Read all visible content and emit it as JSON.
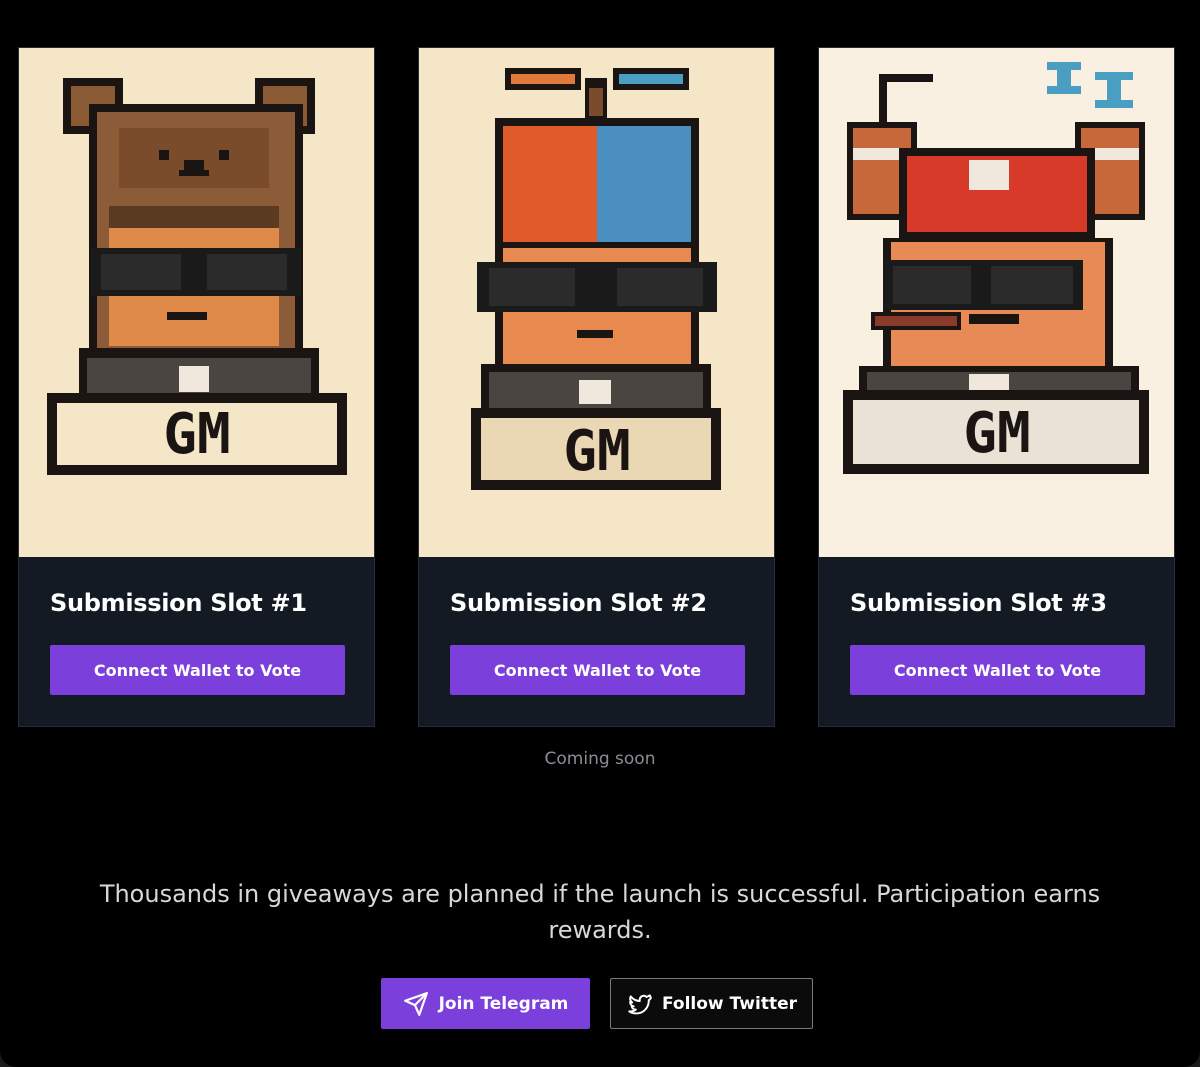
{
  "cards": [
    {
      "title": "Submission Slot #1",
      "button": "Connect Wallet to Vote",
      "art_badge": "GM",
      "art_icon": "bear-hat-pixel-avatar"
    },
    {
      "title": "Submission Slot #2",
      "button": "Connect Wallet to Vote",
      "art_badge": "GM",
      "art_icon": "propeller-cap-pixel-avatar"
    },
    {
      "title": "Submission Slot #3",
      "button": "Connect Wallet to Vote",
      "art_badge": "GM",
      "art_icon": "red-cap-cigar-pixel-avatar"
    }
  ],
  "status_text": "Coming soon",
  "promo_text": "Thousands in giveaways are planned if the launch is successful. Participation earns rewards.",
  "actions": {
    "telegram": {
      "label": "Join Telegram",
      "icon": "paper-plane-icon"
    },
    "twitter": {
      "label": "Follow Twitter",
      "icon": "twitter-bird-icon"
    }
  },
  "colors": {
    "accent": "#7b3fdc",
    "card_bg": "#131a24",
    "page_bg": "#000000"
  }
}
